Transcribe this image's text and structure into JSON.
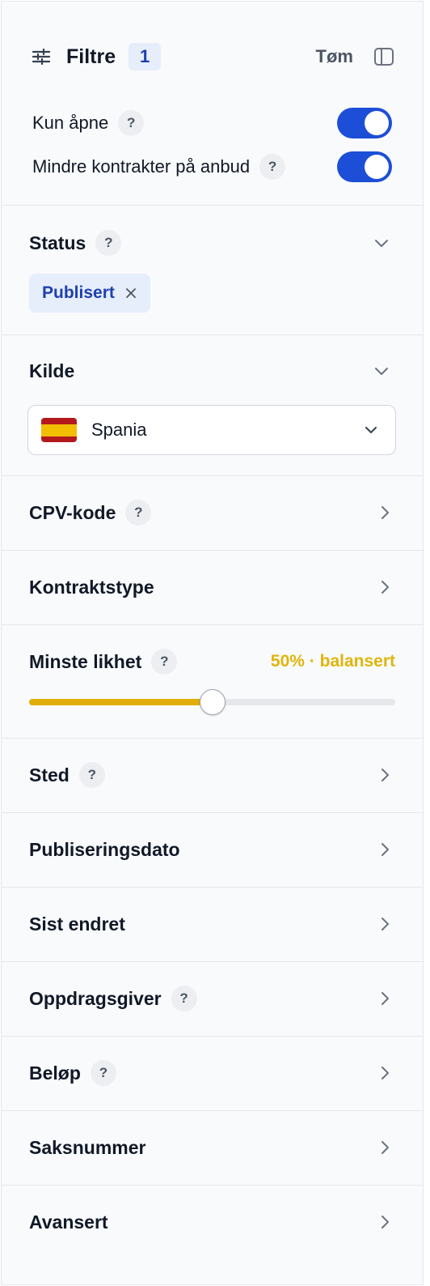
{
  "header": {
    "title": "Filtre",
    "active_count": "1",
    "clear_label": "Tøm",
    "filter_icon": "sliders-icon",
    "panel_icon": "sidebar-toggle-icon"
  },
  "toggles": [
    {
      "label": "Kun åpne",
      "help": "?",
      "on": true
    },
    {
      "label": "Mindre kontrakter på anbud",
      "help": "?",
      "on": true
    }
  ],
  "sections": {
    "status": {
      "title": "Status",
      "help": "?",
      "chip": "Publisert"
    },
    "kilde": {
      "title": "Kilde",
      "selected": "Spania",
      "flag": "spain-flag-icon"
    },
    "cpv": {
      "title": "CPV-kode",
      "help": "?"
    },
    "kontraktstype": {
      "title": "Kontraktstype"
    },
    "likhet": {
      "title": "Minste likhet",
      "help": "?",
      "value_label": "50% · balansert",
      "value": 0.5
    },
    "sted": {
      "title": "Sted",
      "help": "?"
    },
    "publiseringsdato": {
      "title": "Publiseringsdato"
    },
    "sist_endret": {
      "title": "Sist endret"
    },
    "oppdragsgiver": {
      "title": "Oppdragsgiver",
      "help": "?"
    },
    "belop": {
      "title": "Beløp",
      "help": "?"
    },
    "saksnummer": {
      "title": "Saksnummer"
    },
    "avansert": {
      "title": "Avansert"
    }
  },
  "colors": {
    "accent": "#1d4ed8",
    "chip_bg": "#e6eefc",
    "slider": "#e0ad0b",
    "slider_text": "#e0b50c"
  }
}
